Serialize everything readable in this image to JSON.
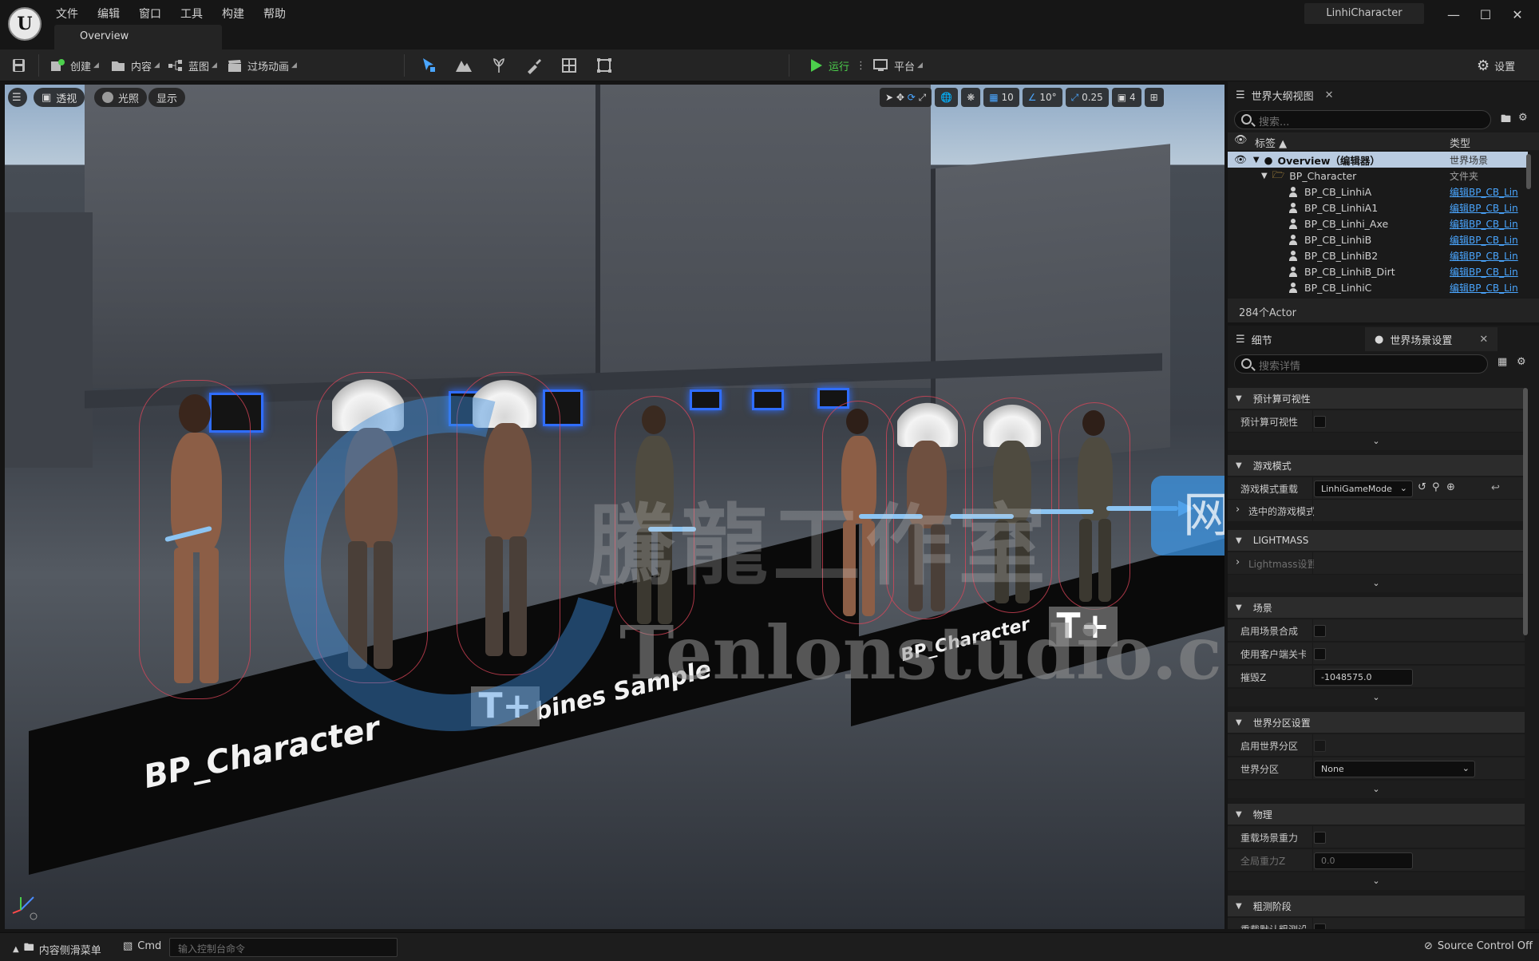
{
  "menu": [
    "文件",
    "编辑",
    "窗口",
    "工具",
    "构建",
    "帮助"
  ],
  "doc_tab": "Overview",
  "project_name": "LinhiCharacter",
  "toolbar": {
    "create": "创建",
    "content": "内容",
    "blueprint": "蓝图",
    "cinematics": "过场动画",
    "play": "运行",
    "platform": "平台",
    "settings": "设置"
  },
  "viewport": {
    "view_mode": "透视",
    "lighting": "光照",
    "show": "显示",
    "grid_snap": "10",
    "angle_snap": "10°",
    "scale_snap": "0.25",
    "camera_speed": "4",
    "floor_label_1": "BP_Character",
    "floor_label_1b": "bines Sample",
    "floor_label_2": "BP_Character",
    "watermark_latin": "Tenlonstudio.com",
    "watermark_cn": "騰龍工作室",
    "watermark_site": "网站",
    "watermark_tplus": "T+"
  },
  "outliner": {
    "tab_title": "世界大纲视图",
    "search_placeholder": "搜索...",
    "col_label": "标签",
    "col_type": "类型",
    "rows": [
      {
        "name": "Overview（编辑器）",
        "type": "世界场景"
      },
      {
        "name": "BP_Character",
        "type": "文件夹"
      },
      {
        "name": "BP_CB_LinhiA",
        "link": "编辑BP_CB_Lin"
      },
      {
        "name": "BP_CB_LinhiA1",
        "link": "编辑BP_CB_Lin"
      },
      {
        "name": "BP_CB_Linhi_Axe",
        "link": "编辑BP_CB_Lin"
      },
      {
        "name": "BP_CB_LinhiB",
        "link": "编辑BP_CB_Lin"
      },
      {
        "name": "BP_CB_LinhiB2",
        "link": "编辑BP_CB_Lin"
      },
      {
        "name": "BP_CB_LinhiB_Dirt",
        "link": "编辑BP_CB_Lin"
      },
      {
        "name": "BP_CB_LinhiC",
        "link": "编辑BP_CB_Lin"
      }
    ],
    "actor_count": "284个Actor"
  },
  "details": {
    "tab_details": "细节",
    "tab_world_settings": "世界场景设置",
    "search_placeholder": "搜索详情",
    "sec_precomputed": "预计算可视性",
    "prop_precomputed": "预计算可视性",
    "sec_gamemode": "游戏模式",
    "prop_gamemode_override": "游戏模式重载",
    "gamemode_value": "LinhiGameMode",
    "prop_selected_gamemode": "选中的游戏模式",
    "sec_lightmass": "LIGHTMASS",
    "prop_lightmass": "Lightmass设置",
    "sec_world": "场景",
    "prop_enable_compositing": "启用场景合成",
    "prop_client_side": "使用客户端关卡",
    "prop_kill_z": "摧毁Z",
    "kill_z_value": "-1048575.0",
    "sec_partition": "世界分区设置",
    "prop_enable_partition": "启用世界分区",
    "prop_partition": "世界分区",
    "partition_value": "None",
    "sec_physics": "物理",
    "prop_override_gravity": "重载场景重力",
    "prop_global_gravity": "全局重力Z",
    "gravity_value": "0.0",
    "sec_broadphase": "粗测阶段",
    "prop_broadphase": "重载默认粗测设"
  },
  "statusbar": {
    "content_drawer": "内容侧滑菜单",
    "cmd": "Cmd",
    "console_placeholder": "输入控制台命令",
    "source_control": "Source Control Off"
  }
}
